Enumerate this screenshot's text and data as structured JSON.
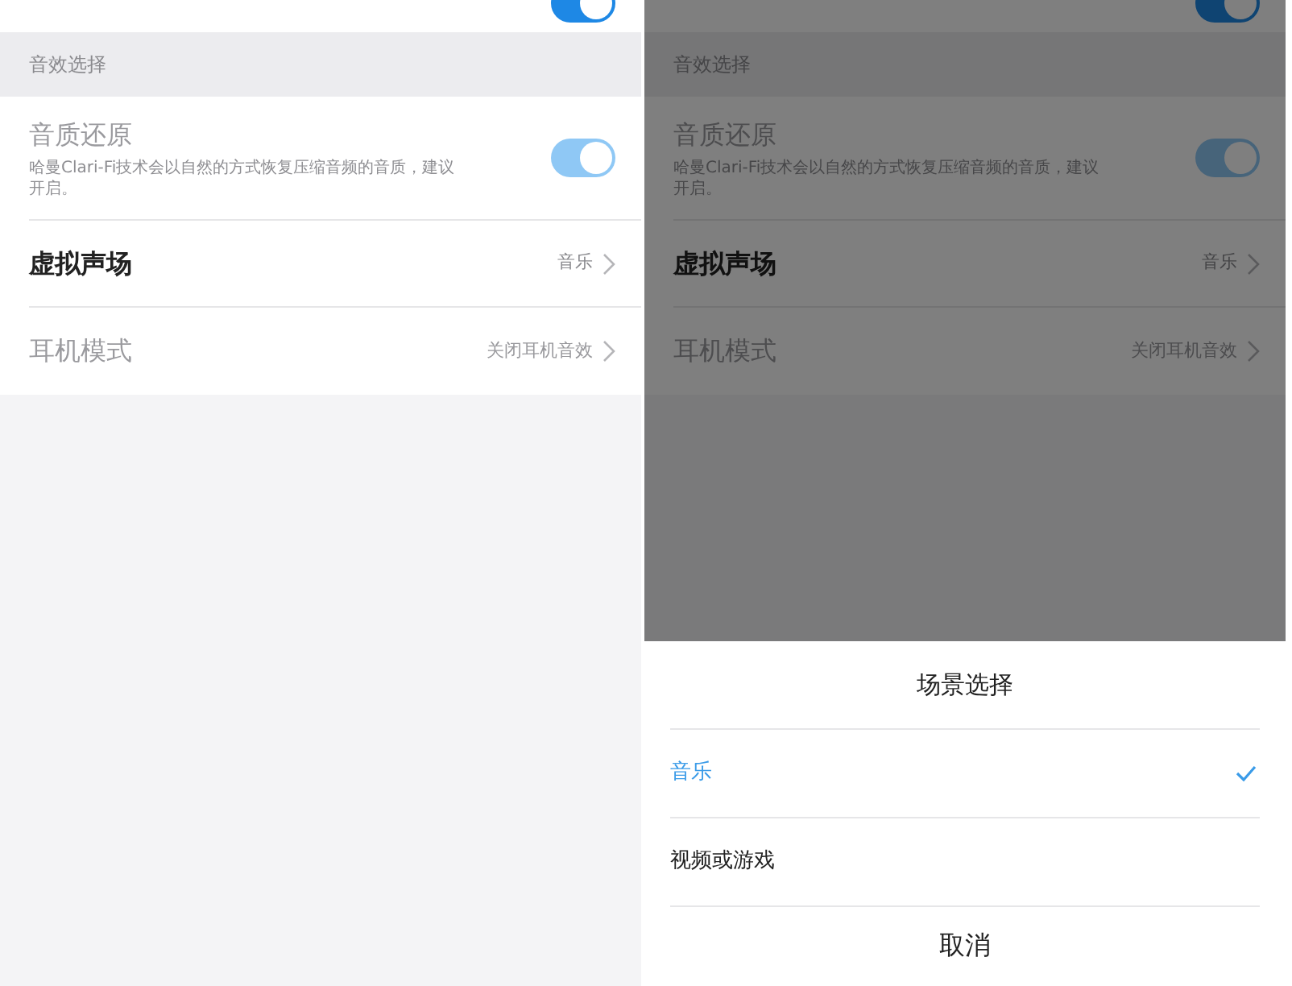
{
  "screens": [
    {
      "dimmed": false,
      "top_row": {
        "on": true
      },
      "section_header": "音效选择",
      "rows": [
        {
          "kind": "toggle",
          "title": "音质还原",
          "description": "哈曼Clari-Fi技术会以自然的方式恢复压缩音频的音质，建议开启。",
          "on": true,
          "disabled": true
        },
        {
          "kind": "link",
          "title": "虚拟声场",
          "value": "音乐",
          "disabled": false
        },
        {
          "kind": "link",
          "title": "耳机模式",
          "value": "关闭耳机音效",
          "disabled": true
        }
      ]
    },
    {
      "dimmed": true,
      "top_row": {
        "on": true
      },
      "section_header": "音效选择",
      "rows": [
        {
          "kind": "toggle",
          "title": "音质还原",
          "description": "哈曼Clari-Fi技术会以自然的方式恢复压缩音频的音质，建议开启。",
          "on": true,
          "disabled": true
        },
        {
          "kind": "link",
          "title": "虚拟声场",
          "value": "音乐",
          "disabled": false
        },
        {
          "kind": "link",
          "title": "耳机模式",
          "value": "关闭耳机音效",
          "disabled": true
        }
      ],
      "sheet": {
        "title": "场景选择",
        "options": [
          {
            "label": "音乐",
            "selected": true
          },
          {
            "label": "视频或游戏",
            "selected": false
          }
        ],
        "cancel": "取消"
      }
    }
  ]
}
